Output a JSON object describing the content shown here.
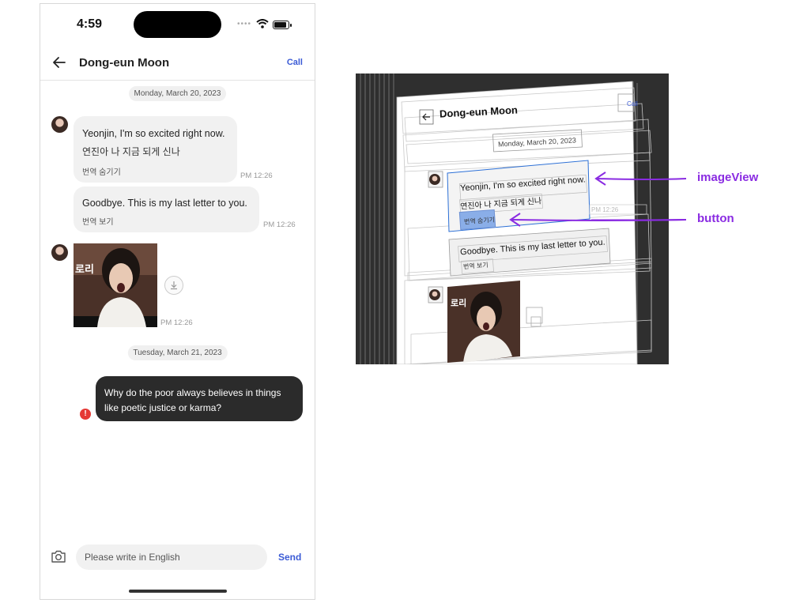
{
  "status_bar": {
    "time": "4:59",
    "signal": "••••"
  },
  "nav": {
    "title": "Dong-eun Moon",
    "call_label": "Call"
  },
  "date_chips": [
    "Monday, March 20, 2023",
    "Tuesday, March 21, 2023"
  ],
  "messages": [
    {
      "text": "Yeonjin, I'm so excited right now.",
      "translation": "연진아 나 지금 되게 신나",
      "toggle": "번역 숨기기",
      "time": "PM 12:26"
    },
    {
      "text": "Goodbye. This is my last letter to you.",
      "toggle": "번역 보기",
      "time": "PM 12:26"
    },
    {
      "image_caption": "로리",
      "time": "PM 12:26"
    }
  ],
  "outgoing": {
    "text": "Why do the poor always believes in things like poetic justice or karma?",
    "error_icon": "!"
  },
  "composer": {
    "placeholder": "Please write in English",
    "send_label": "Send"
  },
  "inspector": {
    "title": "Dong-eun Moon",
    "call": "Call",
    "date": "Monday, March 20, 2023",
    "msg1": "Yeonjin, I'm so excited right now.",
    "kr": "연진아 나 지금 되게 신나",
    "toggle1": "번역 숨기기",
    "msg2": "Goodbye. This is my last letter to you.",
    "toggle2": "번역 보기",
    "time": "PM 12:26"
  },
  "annotations": {
    "imageView": "imageView",
    "button": "button"
  },
  "colors": {
    "accent": "#3b5bd6",
    "annotation": "#8a2be2",
    "error": "#e53935",
    "outgoing_bubble": "#2b2b2b"
  }
}
